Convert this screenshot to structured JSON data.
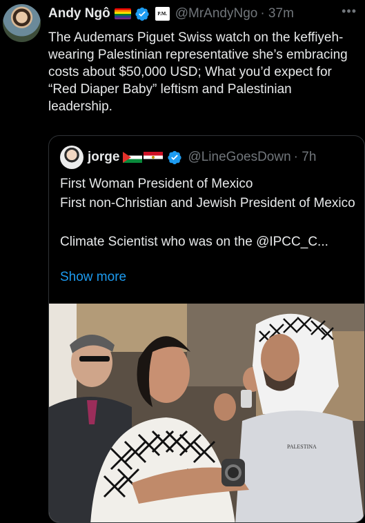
{
  "post": {
    "author_name": "Andy Ngô",
    "author_affiliation_badge": "P.M.",
    "author_handle": "@MrAndyNgo",
    "time": "· 37m",
    "more_icon": "•••",
    "text": "The Audemars Piguet Swiss watch on the keffiyeh-wearing Palestinian representative she’s embracing costs about $50,000 USD; What you’d expect for “Red Diaper Baby” leftism and Palestinian leadership."
  },
  "quote": {
    "author_name": "jorge",
    "author_handle": "@LineGoesDown",
    "time": "· 7h",
    "text": "First Woman President of Mexico\nFirst non-Christian and Jewish President of Mexico\n\nClimate Scientist who was on the @IPCC_C...",
    "show_more": "Show more",
    "photo_shirt_text": "PALESTINA"
  },
  "colors": {
    "background": "#000000",
    "text": "#e7e9ea",
    "secondary": "#71767b",
    "link": "#1d9bf0",
    "border": "#2f3336"
  }
}
